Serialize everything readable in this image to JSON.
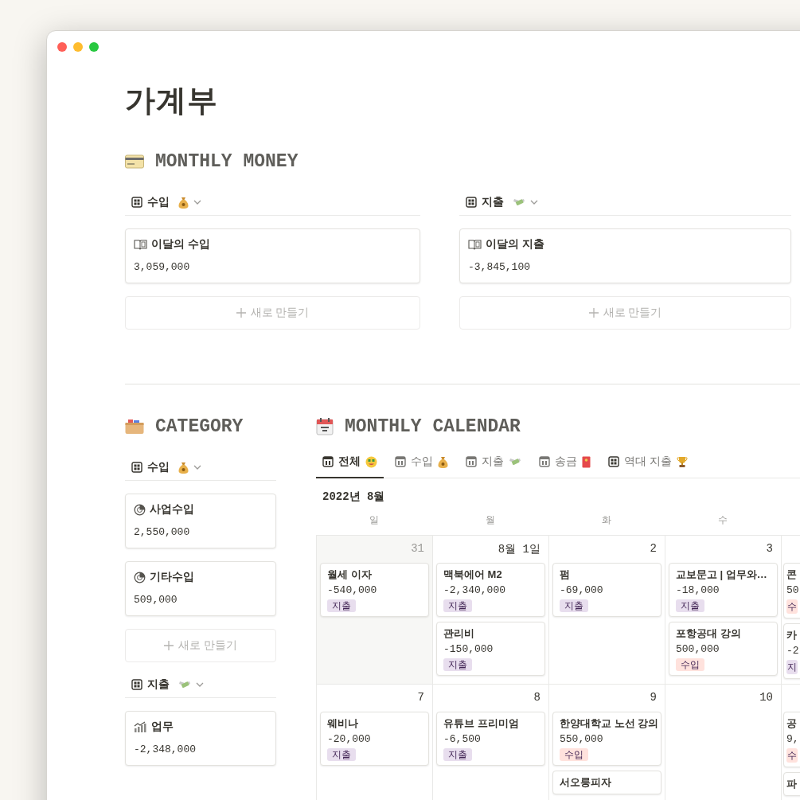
{
  "window": {
    "title": "가계부"
  },
  "monthly_money": {
    "heading": "MONTHLY MONEY",
    "boards": [
      {
        "view": "수입",
        "kind": "income",
        "cards": [
          {
            "title": "이달의 수입",
            "value": "3,059,000"
          }
        ],
        "new_label": "새로 만들기"
      },
      {
        "view": "지출",
        "kind": "expense",
        "cards": [
          {
            "title": "이달의 지출",
            "value": "-3,845,100"
          }
        ],
        "new_label": "새로 만들기"
      }
    ]
  },
  "category": {
    "heading": "CATEGORY",
    "boards": [
      {
        "view": "수입",
        "kind": "income",
        "cards": [
          {
            "title": "사업수입",
            "value": "2,550,000"
          },
          {
            "title": "기타수입",
            "value": "509,000"
          }
        ],
        "new_label": "새로 만들기"
      },
      {
        "view": "지출",
        "kind": "expense",
        "cards": [
          {
            "title": "업무",
            "value": "-2,348,000"
          }
        ]
      }
    ]
  },
  "calendar": {
    "heading": "MONTHLY CALENDAR",
    "tabs": [
      {
        "label": "전체",
        "kind": "calendar",
        "selected": true
      },
      {
        "label": "수입",
        "kind": "calendar",
        "selected": false
      },
      {
        "label": "지출",
        "kind": "calendar",
        "selected": false
      },
      {
        "label": "송금",
        "kind": "calendar",
        "selected": false
      },
      {
        "label": "역대 지출",
        "kind": "table",
        "selected": false
      }
    ],
    "month": "2022년 8월",
    "weekdays": [
      "일",
      "월",
      "화",
      "수"
    ],
    "weeks": [
      {
        "days": [
          {
            "date": "31",
            "in_month": false,
            "events": [
              {
                "title": "월세 이자",
                "amount": "-540,000",
                "tag": {
                  "label": "지출",
                  "color": "#e8deee"
                }
              }
            ]
          },
          {
            "date": "8월 1일",
            "in_month": true,
            "events": [
              {
                "title": "맥북에어 M2",
                "amount": "-2,340,000",
                "tag": {
                  "label": "지출",
                  "color": "#e8deee"
                }
              },
              {
                "title": "관리비",
                "amount": "-150,000",
                "tag": {
                  "label": "지출",
                  "color": "#e8deee"
                }
              }
            ]
          },
          {
            "date": "2",
            "in_month": true,
            "events": [
              {
                "title": "펌",
                "amount": "-69,000",
                "tag": {
                  "label": "지출",
                  "color": "#e8deee"
                }
              }
            ]
          },
          {
            "date": "3",
            "in_month": true,
            "events": [
              {
                "title": "교보문고 | 업무와…",
                "amount": "-18,000",
                "tag": {
                  "label": "지출",
                  "color": "#e8deee"
                }
              },
              {
                "title": "포항공대 강의",
                "amount": "500,000",
                "tag": {
                  "label": "수입",
                  "color": "#ffe2dd"
                }
              }
            ]
          },
          {
            "events": [
              {
                "title": "콘",
                "amount": "50",
                "tag": {
                  "label": "수",
                  "color": "#ffe2dd"
                }
              },
              {
                "title": "카",
                "amount": "-2",
                "tag": {
                  "label": "지",
                  "color": "#e8deee"
                }
              }
            ]
          }
        ]
      },
      {
        "days": [
          {
            "date": "7",
            "in_month": true,
            "events": [
              {
                "title": "웨비나",
                "amount": "-20,000",
                "tag": {
                  "label": "지출",
                  "color": "#e8deee"
                }
              }
            ]
          },
          {
            "date": "8",
            "in_month": true,
            "events": [
              {
                "title": "유튜브 프리미엄",
                "amount": "-6,500",
                "tag": {
                  "label": "지출",
                  "color": "#e8deee"
                }
              }
            ]
          },
          {
            "date": "9",
            "in_month": true,
            "events": [
              {
                "title": "한양대학교 노선 강의",
                "amount": "550,000",
                "tag": {
                  "label": "수입",
                  "color": "#ffe2dd"
                }
              },
              {
                "title": "서오릉피자"
              }
            ]
          },
          {
            "date": "10",
            "in_month": true
          },
          {
            "events": [
              {
                "title": "공",
                "amount": "9,",
                "tag": {
                  "label": "수",
                  "color": "#ffe2dd"
                }
              },
              {
                "title": "파"
              }
            ]
          }
        ]
      }
    ]
  }
}
